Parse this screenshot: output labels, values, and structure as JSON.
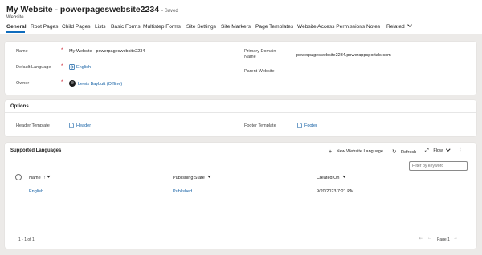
{
  "record": {
    "title": "My Website - powerpageswebsite2234",
    "status": "- Saved",
    "entity": "Website"
  },
  "tabs": [
    {
      "label": "General",
      "active": true
    },
    {
      "label": "Root Pages"
    },
    {
      "label": "Child Pages"
    },
    {
      "label": "Lists"
    },
    {
      "label": "Basic Forms"
    },
    {
      "label": "Multistep Forms"
    },
    {
      "label": "Site Settings"
    },
    {
      "label": "Site Markers"
    },
    {
      "label": "Page Templates"
    },
    {
      "label": "Website Access Permissions"
    },
    {
      "label": "Notes"
    },
    {
      "label": "Related"
    }
  ],
  "general": {
    "name_label": "Name",
    "name_value": "My Website - powerpageswebsite2234",
    "language_label": "Default Language",
    "language_value": "English",
    "owner_label": "Owner",
    "owner_value": "Lewis Baybutt (Offline)",
    "domain_label": "Primary Domain Name",
    "domain_value": "powerpageswebsite2234.powerappsportals.com",
    "parent_label": "Parent Website",
    "parent_value": "---",
    "required_mark": "*"
  },
  "options": {
    "title": "Options",
    "header_label": "Header Template",
    "header_value": "Header",
    "footer_label": "Footer Template",
    "footer_value": "Footer"
  },
  "languages": {
    "title": "Supported Languages",
    "new_button": "New Website Language",
    "refresh_button": "Refresh",
    "flow_button": "Flow",
    "filter_placeholder": "Filter by keyword",
    "columns": [
      "Name",
      "Publishing State",
      "Created On"
    ],
    "sort_indicator": "↑",
    "rows": [
      {
        "name": "English",
        "state": "Published",
        "created": "9/20/2023 7:21 PM"
      }
    ],
    "record_count": "1 - 1 of 1",
    "page_label": "Page 1"
  }
}
